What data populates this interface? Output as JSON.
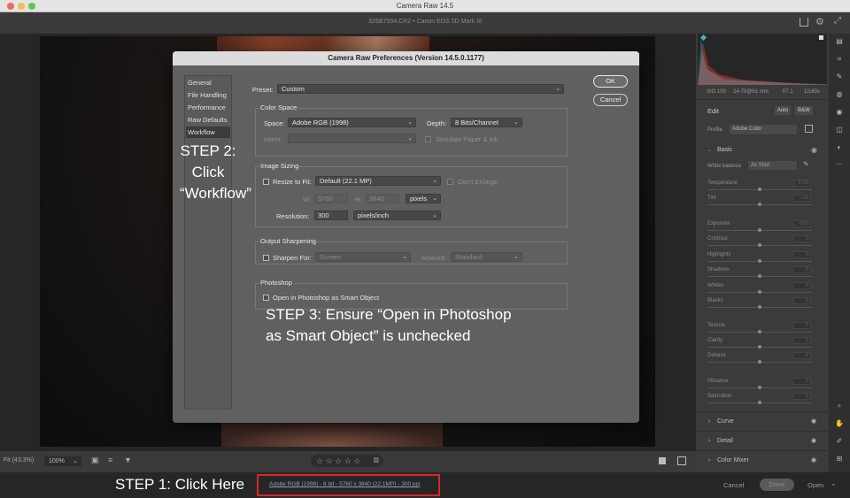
{
  "window": {
    "title": "Camera Raw 14.5",
    "file_info": "3Z6B7594.CR2  •  Canon EOS 5D Mark III"
  },
  "dialog": {
    "title": "Camera Raw Preferences  (Version 14.5.0.1177)",
    "nav": [
      "General",
      "File Handling",
      "Performance",
      "Raw Defaults",
      "Workflow"
    ],
    "selected_nav": "Workflow",
    "ok_label": "OK",
    "cancel_label": "Cancel",
    "preset_label": "Preset:",
    "preset_value": "Custom",
    "color_space": {
      "title": "Color Space",
      "space_label": "Space:",
      "space_value": "Adobe RGB (1998)",
      "depth_label": "Depth:",
      "depth_value": "8 Bits/Channel",
      "intent_label": "Intent:",
      "intent_value": "",
      "simulate_label": "Simulate Paper & Ink"
    },
    "image_sizing": {
      "title": "Image Sizing",
      "resize_label": "Resize to Fit:",
      "resize_value": "Default  (22.1 MP)",
      "dont_enlarge_label": "Don't Enlarge",
      "w_label": "W:",
      "w_value": "5760",
      "h_label": "H:",
      "h_value": "3840",
      "unit_value": "pixels",
      "resolution_label": "Resolution:",
      "resolution_value": "300",
      "res_unit_value": "pixels/inch"
    },
    "output_sharpening": {
      "title": "Output Sharpening",
      "sharpen_label": "Sharpen For:",
      "sharpen_value": "Screen",
      "amount_label": "Amount:",
      "amount_value": "Standard"
    },
    "photoshop": {
      "title": "Photoshop",
      "smart_object_label": "Open in Photoshop as Smart Object"
    }
  },
  "annotations": {
    "step2_line1": "STEP 2:",
    "step2_line2": "Click",
    "step2_line3": "“Workflow”",
    "step3_line1": "STEP 3:  Ensure “Open in Photoshop",
    "step3_line2": "as Smart Object” is unchecked",
    "step1": "STEP 1:  Click Here"
  },
  "bottom_bar": {
    "fit_label": "Fit (43.3%)",
    "zoom_value": "100%",
    "stars": "☆ ☆ ☆ ☆ ☆"
  },
  "footer": {
    "workflow_link": "Adobe RGB (1998) - 8 bit - 5760 x 3840 (22.1MP) - 300 ppi",
    "cancel_label": "Cancel",
    "done_label": "Done",
    "open_label": "Open"
  },
  "right_panel": {
    "info": [
      "ISO 100",
      "24-70@61 mm",
      "f/7.1",
      "1/160s"
    ],
    "edit_label": "Edit",
    "auto_label": "Auto",
    "bw_label": "B&W",
    "profile_label": "Profile",
    "profile_value": "Adobe Color",
    "basic_label": "Basic",
    "white_balance_label": "White balance",
    "white_balance_value": "As Shot",
    "sliders": [
      {
        "label": "Temperature",
        "value": "5700"
      },
      {
        "label": "Tint",
        "value": "+16"
      },
      {
        "label": "Exposure",
        "value": "0.00"
      },
      {
        "label": "Contrast",
        "value": "0"
      },
      {
        "label": "Highlights",
        "value": "0"
      },
      {
        "label": "Shadows",
        "value": "0"
      },
      {
        "label": "Whites",
        "value": "0"
      },
      {
        "label": "Blacks",
        "value": "0"
      },
      {
        "label": "Texture",
        "value": "0"
      },
      {
        "label": "Clarity",
        "value": "0"
      },
      {
        "label": "Dehaze",
        "value": "0"
      },
      {
        "label": "Vibrance",
        "value": "0"
      },
      {
        "label": "Saturation",
        "value": "0"
      }
    ],
    "sections": [
      "Curve",
      "Detail",
      "Color Mixer"
    ]
  },
  "colors": {
    "annotation_red": "#d9262b",
    "dialog_bg": "#606060"
  }
}
